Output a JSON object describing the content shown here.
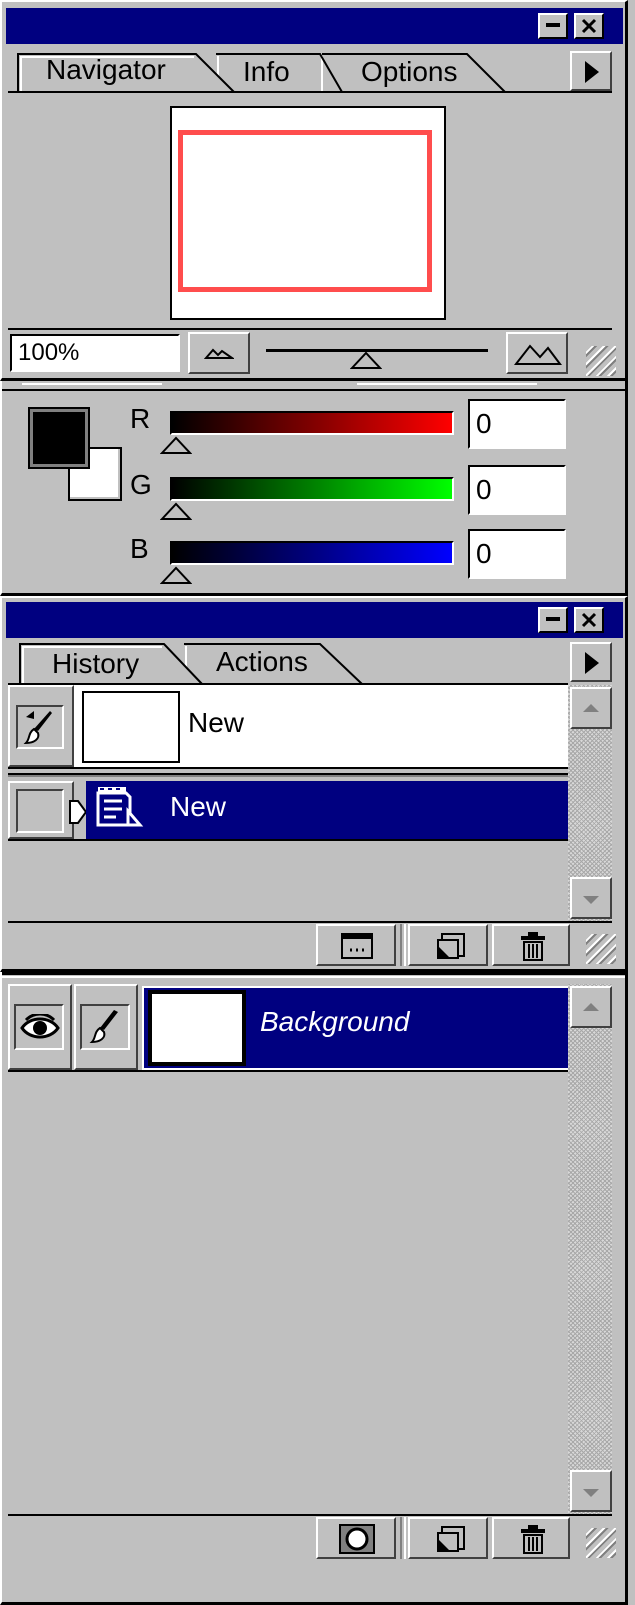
{
  "navigator_panel": {
    "tabs": [
      {
        "label": "Navigator",
        "active": true
      },
      {
        "label": "Info",
        "active": false
      },
      {
        "label": "Options",
        "active": false
      }
    ],
    "zoom_value": "100%",
    "zoom_slider_percent": 45,
    "preview_frame_color": "#ff4d4d"
  },
  "color_panel": {
    "channels": [
      {
        "label": "R",
        "value": "0",
        "gradient_end": "#ff0000"
      },
      {
        "label": "G",
        "value": "0",
        "gradient_end": "#00ff00"
      },
      {
        "label": "B",
        "value": "0",
        "gradient_end": "#0000ff"
      }
    ],
    "foreground_color": "#000000",
    "background_color": "#ffffff"
  },
  "history_panel": {
    "tabs": [
      {
        "label": "History",
        "active": true
      },
      {
        "label": "Actions",
        "active": false
      }
    ],
    "snapshot": {
      "label": "New",
      "icon": "art-brush-icon"
    },
    "states": [
      {
        "label": "New",
        "selected": true,
        "icon": "new-document-icon"
      }
    ],
    "footer_buttons": [
      "new-document-from-state-icon",
      "new-snapshot-icon",
      "trash-icon"
    ]
  },
  "layers_panel": {
    "layers": [
      {
        "name": "Background",
        "visible": true,
        "selected": true
      }
    ],
    "footer_buttons": [
      "add-mask-icon",
      "new-layer-icon",
      "trash-icon"
    ]
  },
  "colors": {
    "title_bar": "#000080",
    "selection": "#000080",
    "face": "#c0c0c0"
  }
}
